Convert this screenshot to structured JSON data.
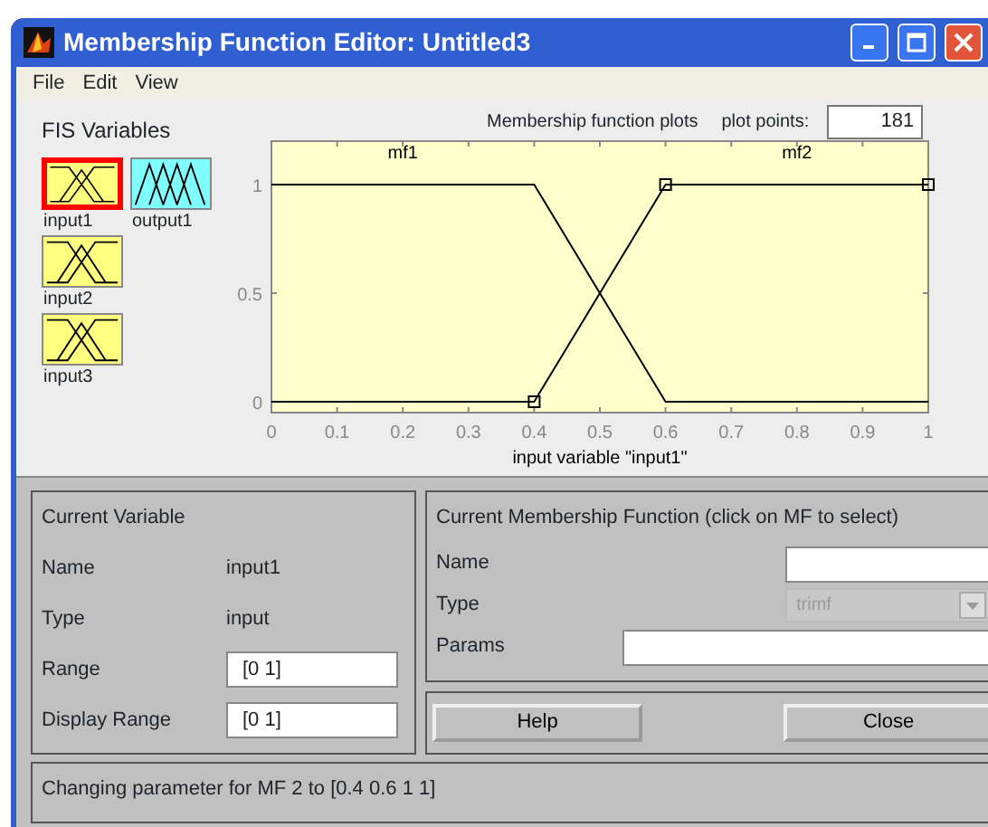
{
  "window": {
    "title": "Membership Function Editor: Untitled3",
    "menu": [
      "File",
      "Edit",
      "View"
    ]
  },
  "fis_variables": {
    "title": "FIS Variables",
    "items": [
      {
        "label": "input1",
        "kind": "input",
        "selected": true
      },
      {
        "label": "output1",
        "kind": "output",
        "selected": false
      },
      {
        "label": "input2",
        "kind": "input",
        "selected": false
      },
      {
        "label": "input3",
        "kind": "input",
        "selected": false
      }
    ]
  },
  "plot_header": {
    "title": "Membership function plots",
    "plot_points_label": "plot points:",
    "plot_points": "181"
  },
  "chart_data": {
    "type": "line",
    "xlabel": "input variable \"input1\"",
    "x": [
      0,
      0.4,
      0.6,
      1
    ],
    "series": [
      {
        "name": "mf1",
        "color": "#000000",
        "values": [
          1,
          1,
          0,
          0
        ]
      },
      {
        "name": "mf2",
        "color": "#000000",
        "values": [
          0,
          0,
          1,
          1
        ]
      }
    ],
    "xlim": [
      0,
      1
    ],
    "ylim": [
      -0.05,
      1.2
    ],
    "xticks": [
      0,
      0.1,
      0.2,
      0.3,
      0.4,
      0.5,
      0.6,
      0.7,
      0.8,
      0.9,
      1
    ],
    "yticks": [
      0,
      0.5,
      1
    ]
  },
  "plot_state": {
    "mfs": [
      {
        "selected": false
      },
      {
        "selected": true
      }
    ]
  },
  "current_variable": {
    "title": "Current Variable",
    "fields": [
      {
        "label": "Name",
        "value": "input1",
        "kind": "text"
      },
      {
        "label": "Type",
        "value": "input",
        "kind": "text"
      },
      {
        "label": "Range",
        "value": "[0 1]",
        "kind": "input"
      },
      {
        "label": "Display Range",
        "value": "[0 1]",
        "kind": "input"
      }
    ]
  },
  "current_mf": {
    "title": "Current Membership Function (click on MF to select)",
    "fields": [
      {
        "label": "Name",
        "kind": "input"
      },
      {
        "label": "Type",
        "kind": "select",
        "value": "trimf",
        "disabled": true
      },
      {
        "label": "Params",
        "kind": "wide-input"
      }
    ]
  },
  "buttons": [
    "Help",
    "Close"
  ],
  "status": "Changing parameter for MF 2 to  [0.4 0.6 1 1]"
}
